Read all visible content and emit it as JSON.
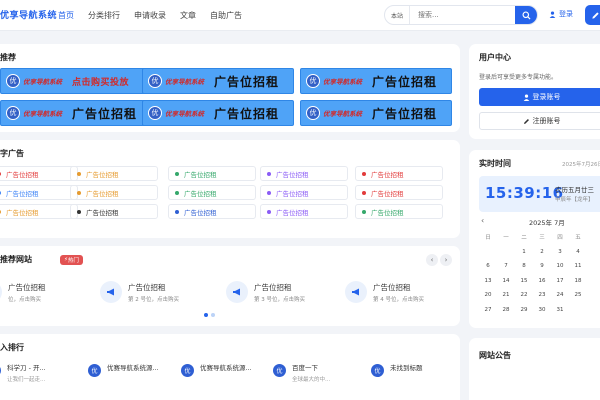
{
  "header": {
    "logo": "优享导航系统",
    "nav": [
      "首页",
      "分类排行",
      "申请收录",
      "文章",
      "自助广告"
    ],
    "search_site": "本站",
    "search_placeholder": "搜索...",
    "login": "登录"
  },
  "recommend": {
    "title": "推荐",
    "badge": "优",
    "site_name": "优享导航系统",
    "items": [
      {
        "slogan": "点击购买投放",
        "small": true
      },
      {
        "slogan": "广告位招租",
        "small": false
      },
      {
        "slogan": "广告位招租",
        "small": false
      },
      {
        "slogan": "广告位招租",
        "small": false
      },
      {
        "slogan": "广告位招租",
        "small": false
      },
      {
        "slogan": "广告位招租",
        "small": false
      }
    ]
  },
  "text_ads": {
    "title": "字广告",
    "label": "广告位招租",
    "colors": [
      "#e23b3b",
      "#e69b2f",
      "#35a86b",
      "#8b5cf6",
      "#e23b3b",
      "#3b82f6",
      "#e69b2f",
      "#35a86b",
      "#8b5cf6",
      "#e23b3b",
      "#e69b2f",
      "#333333",
      "#2f5fd3",
      "#8b5cf6",
      "#35a86b"
    ]
  },
  "recommend_sites": {
    "title": "推荐网站",
    "hot": "热门",
    "items": [
      {
        "name": "广告位招租",
        "desc": "位，点击购买"
      },
      {
        "name": "广告位招租",
        "desc": "第 2 号位，点击购买"
      },
      {
        "name": "广告位招租",
        "desc": "第 3 号位，点击购买"
      },
      {
        "name": "广告位招租",
        "desc": "第 4 号位，点击购买"
      }
    ]
  },
  "ranking": {
    "title": "入排行",
    "items": [
      {
        "name": "科学刀 - 开...",
        "desc": "让我们一起走..."
      },
      {
        "name": "优赛导航系统源...",
        "desc": ""
      },
      {
        "name": "优赛导航系统源...",
        "desc": ""
      },
      {
        "name": "百度一下",
        "desc": "全球最大的中..."
      },
      {
        "name": "未找到标题",
        "desc": ""
      }
    ]
  },
  "user_center": {
    "title": "用户中心",
    "desc": "登录后可享受更多专属功能。",
    "login_btn": "登录账号",
    "register_btn": "注册账号"
  },
  "realtime": {
    "title": "实时时间",
    "date": "2025年7月26日",
    "clock": "15:39:16",
    "lunar": "农历五月廿三",
    "ganzhi": "甲辰年【龙年】",
    "month": "2025年 7月",
    "weekdays": [
      "日",
      "一",
      "二",
      "三",
      "四",
      "五"
    ],
    "weeks": [
      [
        "",
        "",
        "1",
        "2",
        "3",
        "4"
      ],
      [
        "6",
        "7",
        "8",
        "9",
        "10",
        "11"
      ],
      [
        "13",
        "14",
        "15",
        "16",
        "17",
        "18"
      ],
      [
        "20",
        "21",
        "22",
        "23",
        "24",
        "25"
      ],
      [
        "27",
        "28",
        "29",
        "30",
        "31",
        ""
      ]
    ],
    "today": "26"
  },
  "notice": {
    "title": "网站公告"
  }
}
